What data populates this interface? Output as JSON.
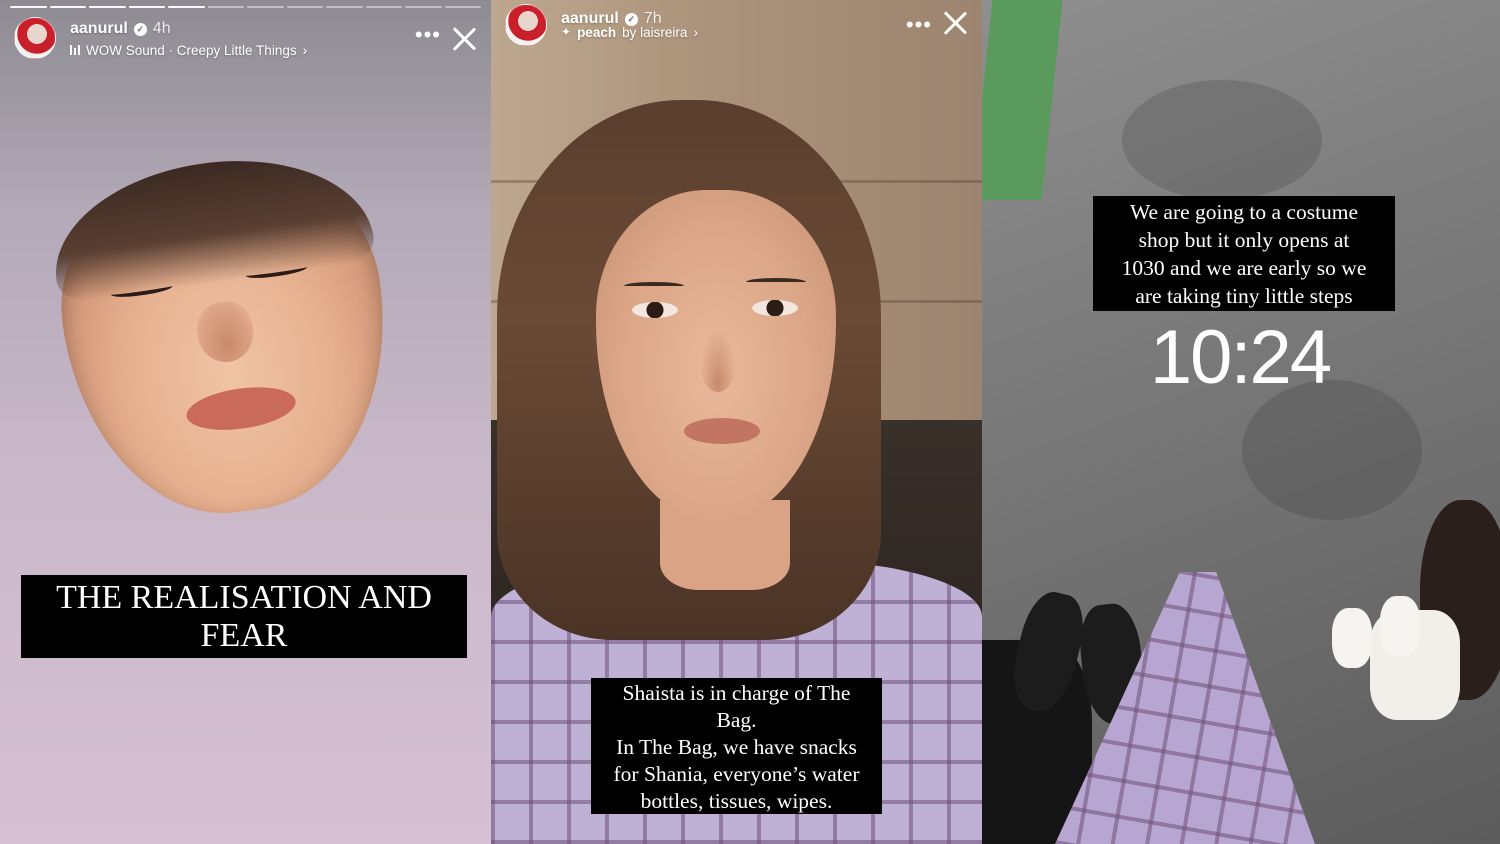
{
  "stories": [
    {
      "username": "aanurul",
      "time": "4h",
      "audio_label": "WOW Sound · Creepy Little Things",
      "caption": "THE REALISATION AND FEAR"
    },
    {
      "username": "aanurul",
      "time": "7h",
      "audio_track": "peach",
      "audio_by": "by laisreira",
      "caption_lines": [
        "Shaista is in charge of  The",
        "Bag.",
        "In The Bag, we have snacks",
        "for Shania, everyone’s water",
        "bottles, tissues, wipes."
      ]
    },
    {
      "caption_lines": [
        "We are going to a costume",
        "shop but it only opens at",
        "1030 and we are early so we",
        "are taking tiny little steps"
      ],
      "timestamp": "10:24"
    }
  ],
  "icons": {
    "verified": "verified-badge-icon",
    "more": "more-options-icon",
    "close": "close-icon",
    "audio": "audio-bars-icon",
    "effect": "sparkle-icon"
  },
  "colors": {
    "caption_bg": "#000000",
    "caption_text": "#ffffff"
  }
}
